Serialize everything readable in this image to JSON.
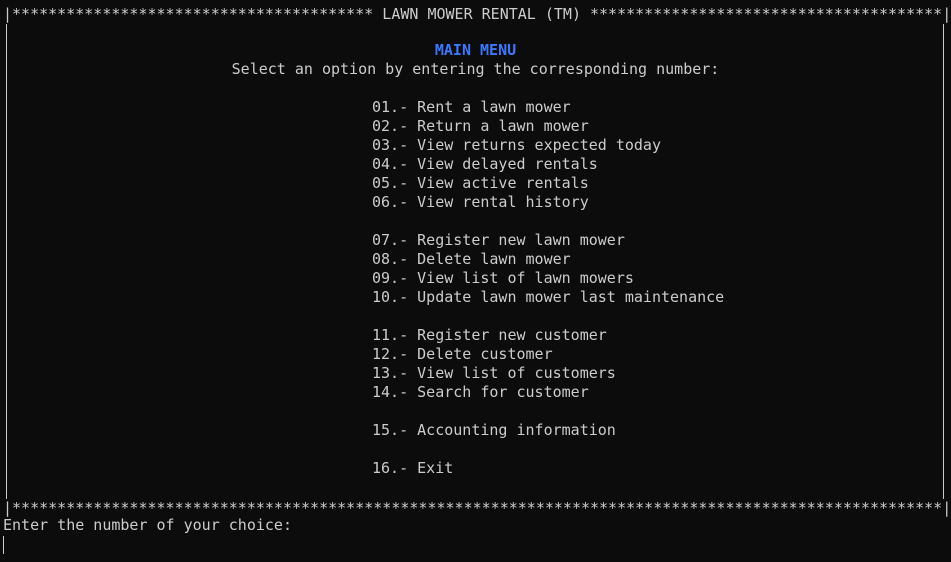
{
  "colors": {
    "background": "#0c0c0c",
    "text": "#cccccc",
    "title": "#3b78ff"
  },
  "border": {
    "top": "|**************************************** LAWN MOWER RENTAL (TM) ***************************************|",
    "bottom": "|*******************************************************************************************************|"
  },
  "menu": {
    "title": "MAIN MENU",
    "subtitle": "Select an option by entering the corresponding number:",
    "items": [
      {
        "number": "01.-",
        "label": "Rent a lawn mower"
      },
      {
        "number": "02.-",
        "label": "Return a lawn mower"
      },
      {
        "number": "03.-",
        "label": "View returns expected today"
      },
      {
        "number": "04.-",
        "label": "View delayed rentals"
      },
      {
        "number": "05.-",
        "label": "View active rentals"
      },
      {
        "number": "06.-",
        "label": "View rental history"
      },
      {
        "number": "07.-",
        "label": "Register new lawn mower"
      },
      {
        "number": "08.-",
        "label": "Delete lawn mower"
      },
      {
        "number": "09.-",
        "label": "View list of lawn mowers"
      },
      {
        "number": "10.-",
        "label": "Update lawn mower last maintenance"
      },
      {
        "number": "11.-",
        "label": "Register new customer"
      },
      {
        "number": "12.-",
        "label": "Delete customer"
      },
      {
        "number": "13.-",
        "label": "View list of customers"
      },
      {
        "number": "14.-",
        "label": "Search for customer"
      },
      {
        "number": "15.-",
        "label": "Accounting information"
      },
      {
        "number": "16.-",
        "label": "Exit"
      }
    ]
  },
  "prompt": {
    "text": "Enter the number of your choice:"
  }
}
